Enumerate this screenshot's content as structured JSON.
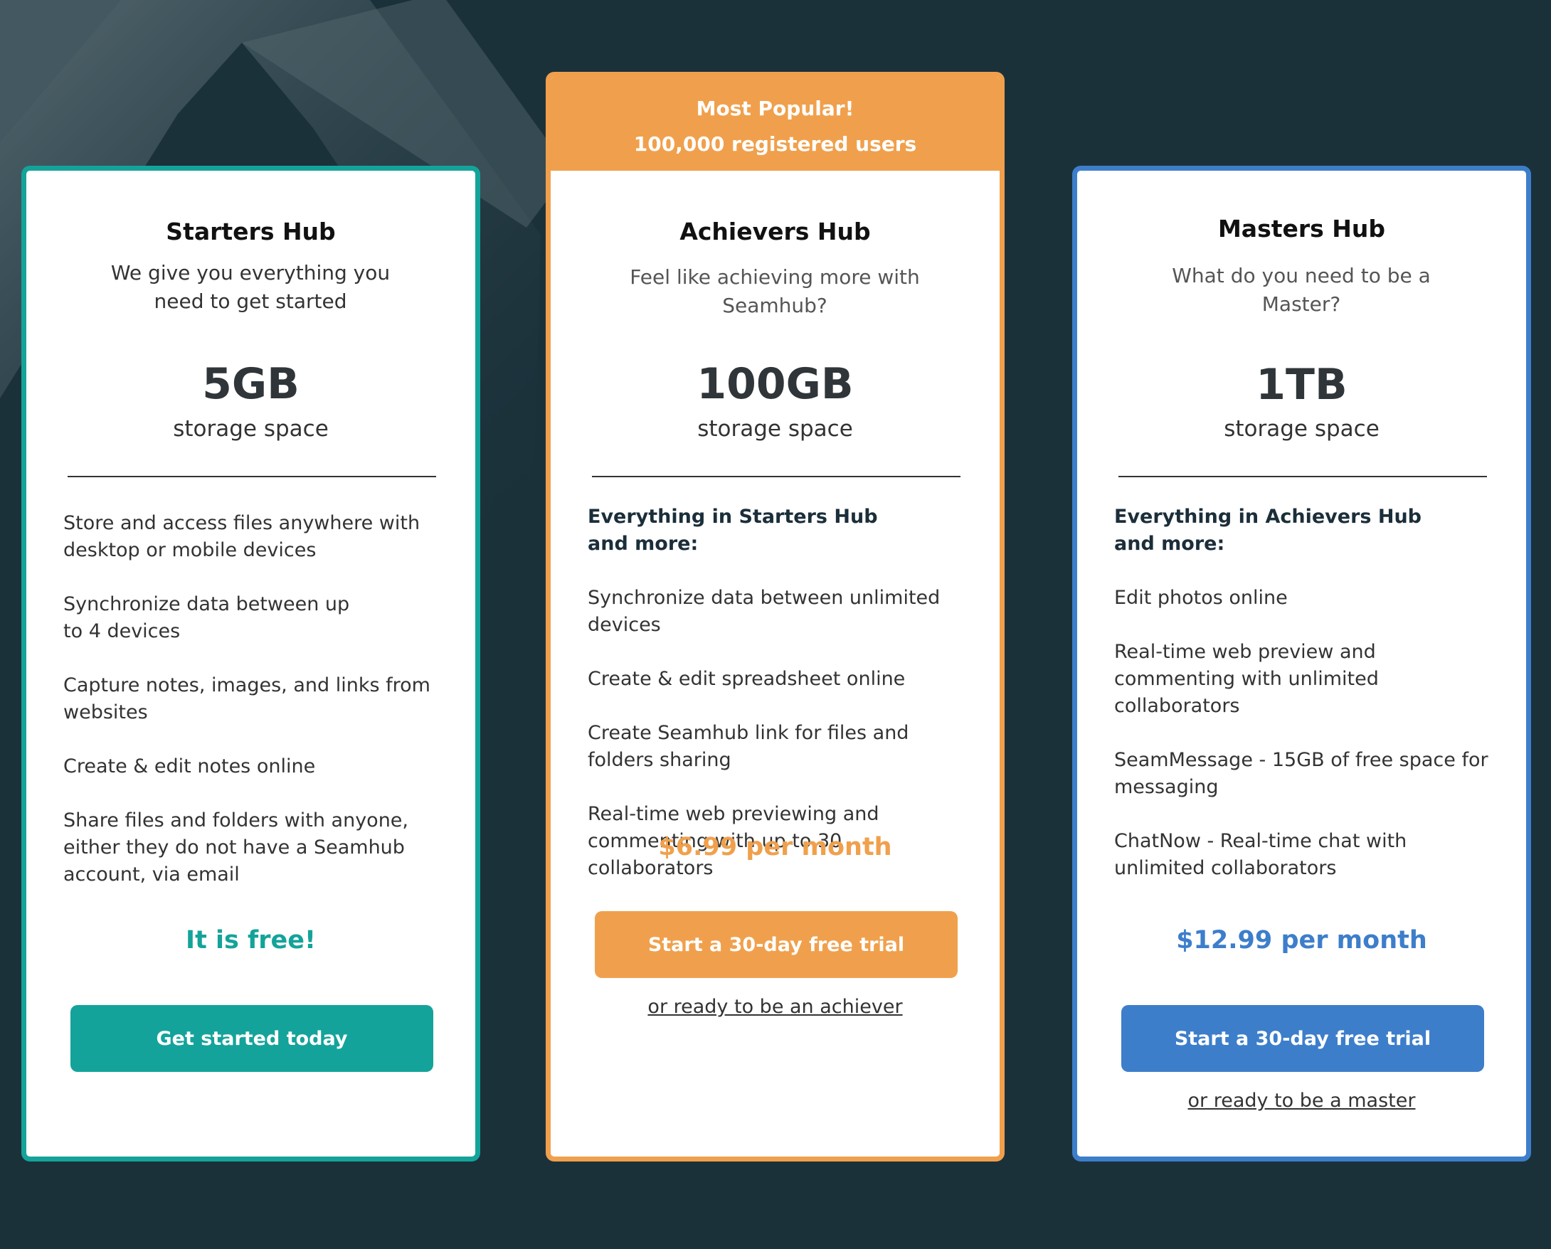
{
  "colors": {
    "background": "#1b313a",
    "starters_accent": "#14a39a",
    "achievers_accent": "#f0a04c",
    "masters_accent": "#3d7ecb"
  },
  "plans": {
    "starters": {
      "name": "Starters Hub",
      "tagline": "We give you everything you need to get started",
      "storage_amount": "5GB",
      "storage_label": "storage space",
      "features": [
        "Store and access files anywhere with\ndesktop or mobile devices",
        "Synchronize data between up\nto 4 devices",
        "Capture notes, images, and links from\nwebsites",
        "Create & edit notes online",
        "Share files and folders with anyone,\neither they do not have a Seamhub\naccount, via email"
      ],
      "price": "It is free!",
      "cta_label": "Get started today"
    },
    "achievers": {
      "banner_line1": "Most Popular!",
      "banner_line2": "100,000 registered users",
      "name": "Achievers Hub",
      "tagline": "Feel like achieving more with Seamhub?",
      "storage_amount": "100GB",
      "storage_label": "storage space",
      "features_heading": "Everything in Starters Hub\nand more:",
      "features": [
        "Synchronize data between unlimited\ndevices",
        "Create & edit spreadsheet online",
        "Create Seamhub link for files and\nfolders sharing",
        "Real-time web previewing and\ncommenting with up to 30\ncollaborators"
      ],
      "price": "$6.99 per month",
      "cta_label": "Start a 30-day free trial",
      "alt_link": "or ready to be an achiever"
    },
    "masters": {
      "name": "Masters Hub",
      "tagline": "What do you need to be a Master?",
      "storage_amount": "1TB",
      "storage_label": "storage space",
      "features_heading": "Everything in Achievers Hub\nand more:",
      "features": [
        "Edit photos online",
        "Real-time web preview and\ncommenting with unlimited\ncollaborators",
        "SeamMessage - 15GB of free space for\nmessaging",
        "ChatNow - Real-time chat with\nunlimited collaborators"
      ],
      "price": "$12.99 per month",
      "cta_label": "Start a 30-day free trial",
      "alt_link": "or ready to be a master"
    }
  }
}
